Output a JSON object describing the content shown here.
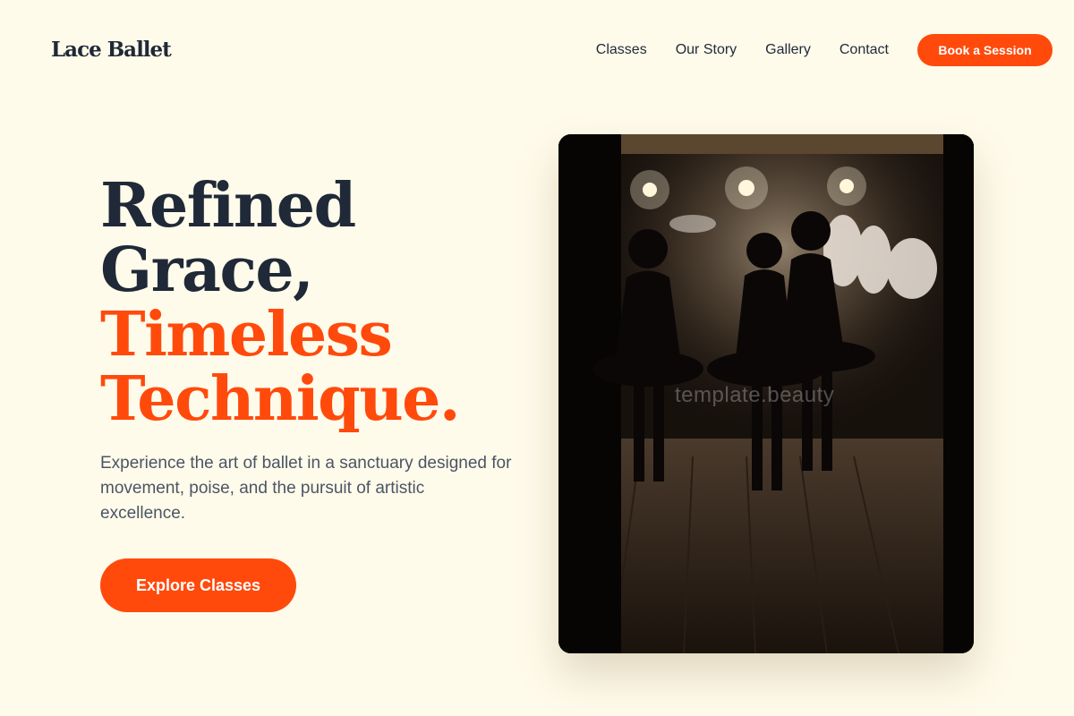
{
  "brand": {
    "name": "Lace Ballet"
  },
  "nav": {
    "items": [
      {
        "label": "Classes"
      },
      {
        "label": "Our Story"
      },
      {
        "label": "Gallery"
      },
      {
        "label": "Contact"
      }
    ],
    "cta_label": "Book a Session"
  },
  "hero": {
    "headline_line1": "Refined",
    "headline_line2": "Grace,",
    "headline_line3": "Timeless",
    "headline_line4": "Technique.",
    "subtext": "Experience the art of ballet in a sanctuary designed for movement, poise, and the pursuit of artistic excellence.",
    "cta_label": "Explore Classes",
    "image_watermark": "template.beauty"
  },
  "colors": {
    "background": "#fffbeb",
    "accent": "#ff4a0c",
    "heading": "#1f2937",
    "body_text": "#4b5563"
  }
}
